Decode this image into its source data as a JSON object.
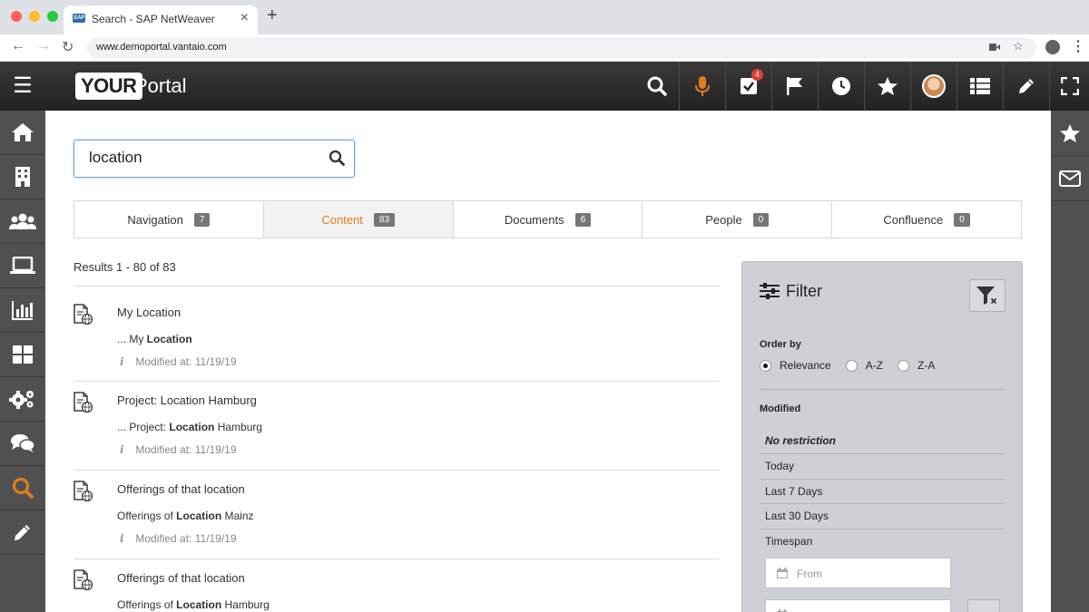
{
  "browser": {
    "tab_title": "Search - SAP NetWeaver Portal",
    "url": "www.demoportal.vantaio.com",
    "tab_close": "×",
    "new_tab": "+"
  },
  "header": {
    "logo_box": "YOUR",
    "logo_text": "Portal",
    "task_badge": "4",
    "accent_color": "#e07b1f"
  },
  "search": {
    "value": "location",
    "placeholder": ""
  },
  "tabs": [
    {
      "label": "Navigation",
      "count": "7"
    },
    {
      "label": "Content",
      "count": "83"
    },
    {
      "label": "Documents",
      "count": "6"
    },
    {
      "label": "People",
      "count": "0"
    },
    {
      "label": "Confluence",
      "count": "0"
    }
  ],
  "results": {
    "count_text": "Results 1 - 80 of 83",
    "items": [
      {
        "title": "My Location",
        "snippet_pre": "... My ",
        "snippet_bold": "Location",
        "snippet_post": "",
        "meta": "Modified at: 11/19/19"
      },
      {
        "title": "Project: Location Hamburg",
        "snippet_pre": "... Project: ",
        "snippet_bold": "Location",
        "snippet_post": " Hamburg",
        "meta": "Modified at: 11/19/19"
      },
      {
        "title": "Offerings of that location",
        "snippet_pre": "Offerings of ",
        "snippet_bold": "Location",
        "snippet_post": " Mainz",
        "meta": "Modified at: 11/19/19"
      },
      {
        "title": "Offerings of that location",
        "snippet_pre": "Offerings of ",
        "snippet_bold": "Location",
        "snippet_post": " Hamburg",
        "meta": ""
      }
    ]
  },
  "filter": {
    "title": "Filter",
    "order_by_label": "Order by",
    "order_options": [
      "Relevance",
      "A-Z",
      "Z-A"
    ],
    "modified_label": "Modified",
    "modified_options": [
      "No restriction",
      "Today",
      "Last 7 Days",
      "Last 30 Days",
      "Timespan"
    ],
    "from_placeholder": "From"
  }
}
